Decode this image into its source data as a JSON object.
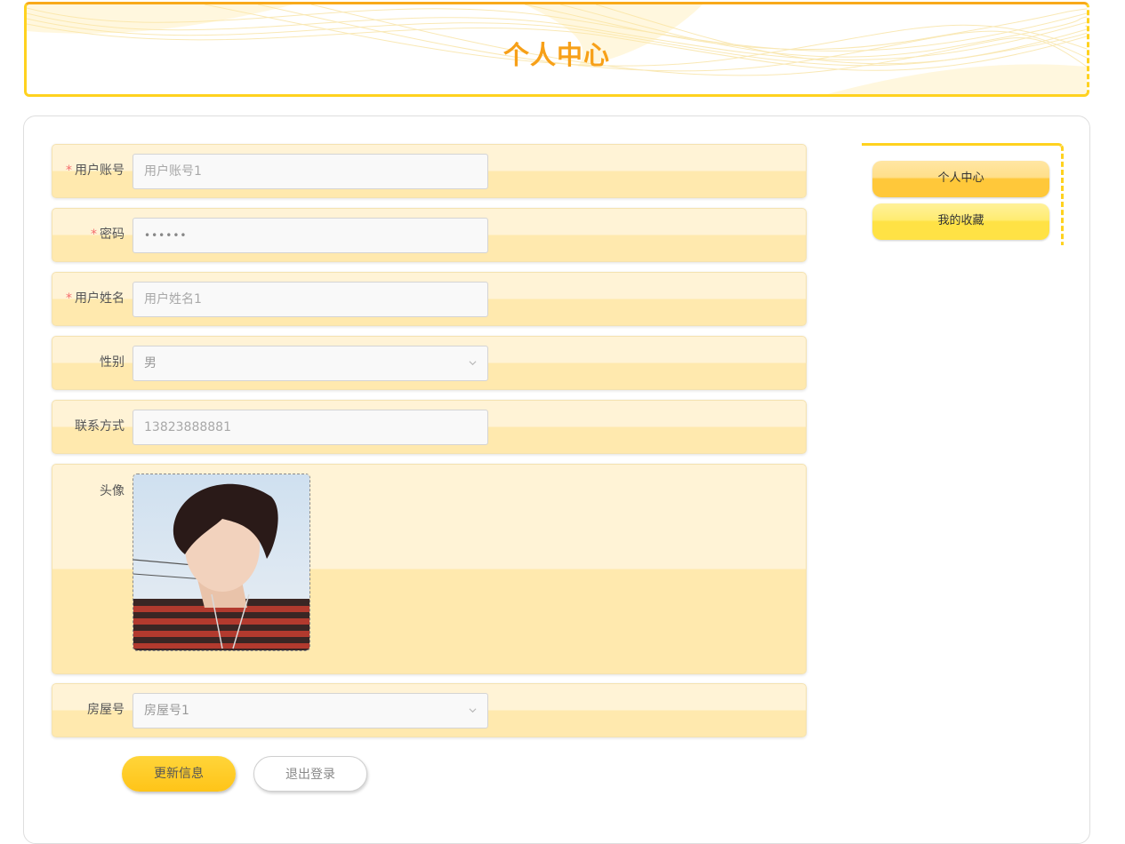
{
  "header": {
    "title": "个人中心"
  },
  "form": {
    "account": {
      "label": "用户账号",
      "required": "*",
      "value": "用户账号1"
    },
    "password": {
      "label": "密码",
      "required": "*",
      "value": "••••••"
    },
    "name": {
      "label": "用户姓名",
      "required": "*",
      "value": "用户姓名1"
    },
    "gender": {
      "label": "性别",
      "value": "男"
    },
    "phone": {
      "label": "联系方式",
      "value": "13823888881"
    },
    "avatar": {
      "label": "头像"
    },
    "house": {
      "label": "房屋号",
      "value": "房屋号1"
    }
  },
  "buttons": {
    "update": "更新信息",
    "logout": "退出登录"
  },
  "side_menu": {
    "items": [
      {
        "label": "个人中心"
      },
      {
        "label": "我的收藏"
      }
    ]
  },
  "icons": {
    "select_arrow": "chevron-down-icon"
  },
  "colors": {
    "accent": "#f7a018",
    "brand_yellow": "#ffd21f",
    "row_top": "#fff3d6",
    "row_bottom": "#ffe9ae",
    "required": "#f56c6c"
  }
}
